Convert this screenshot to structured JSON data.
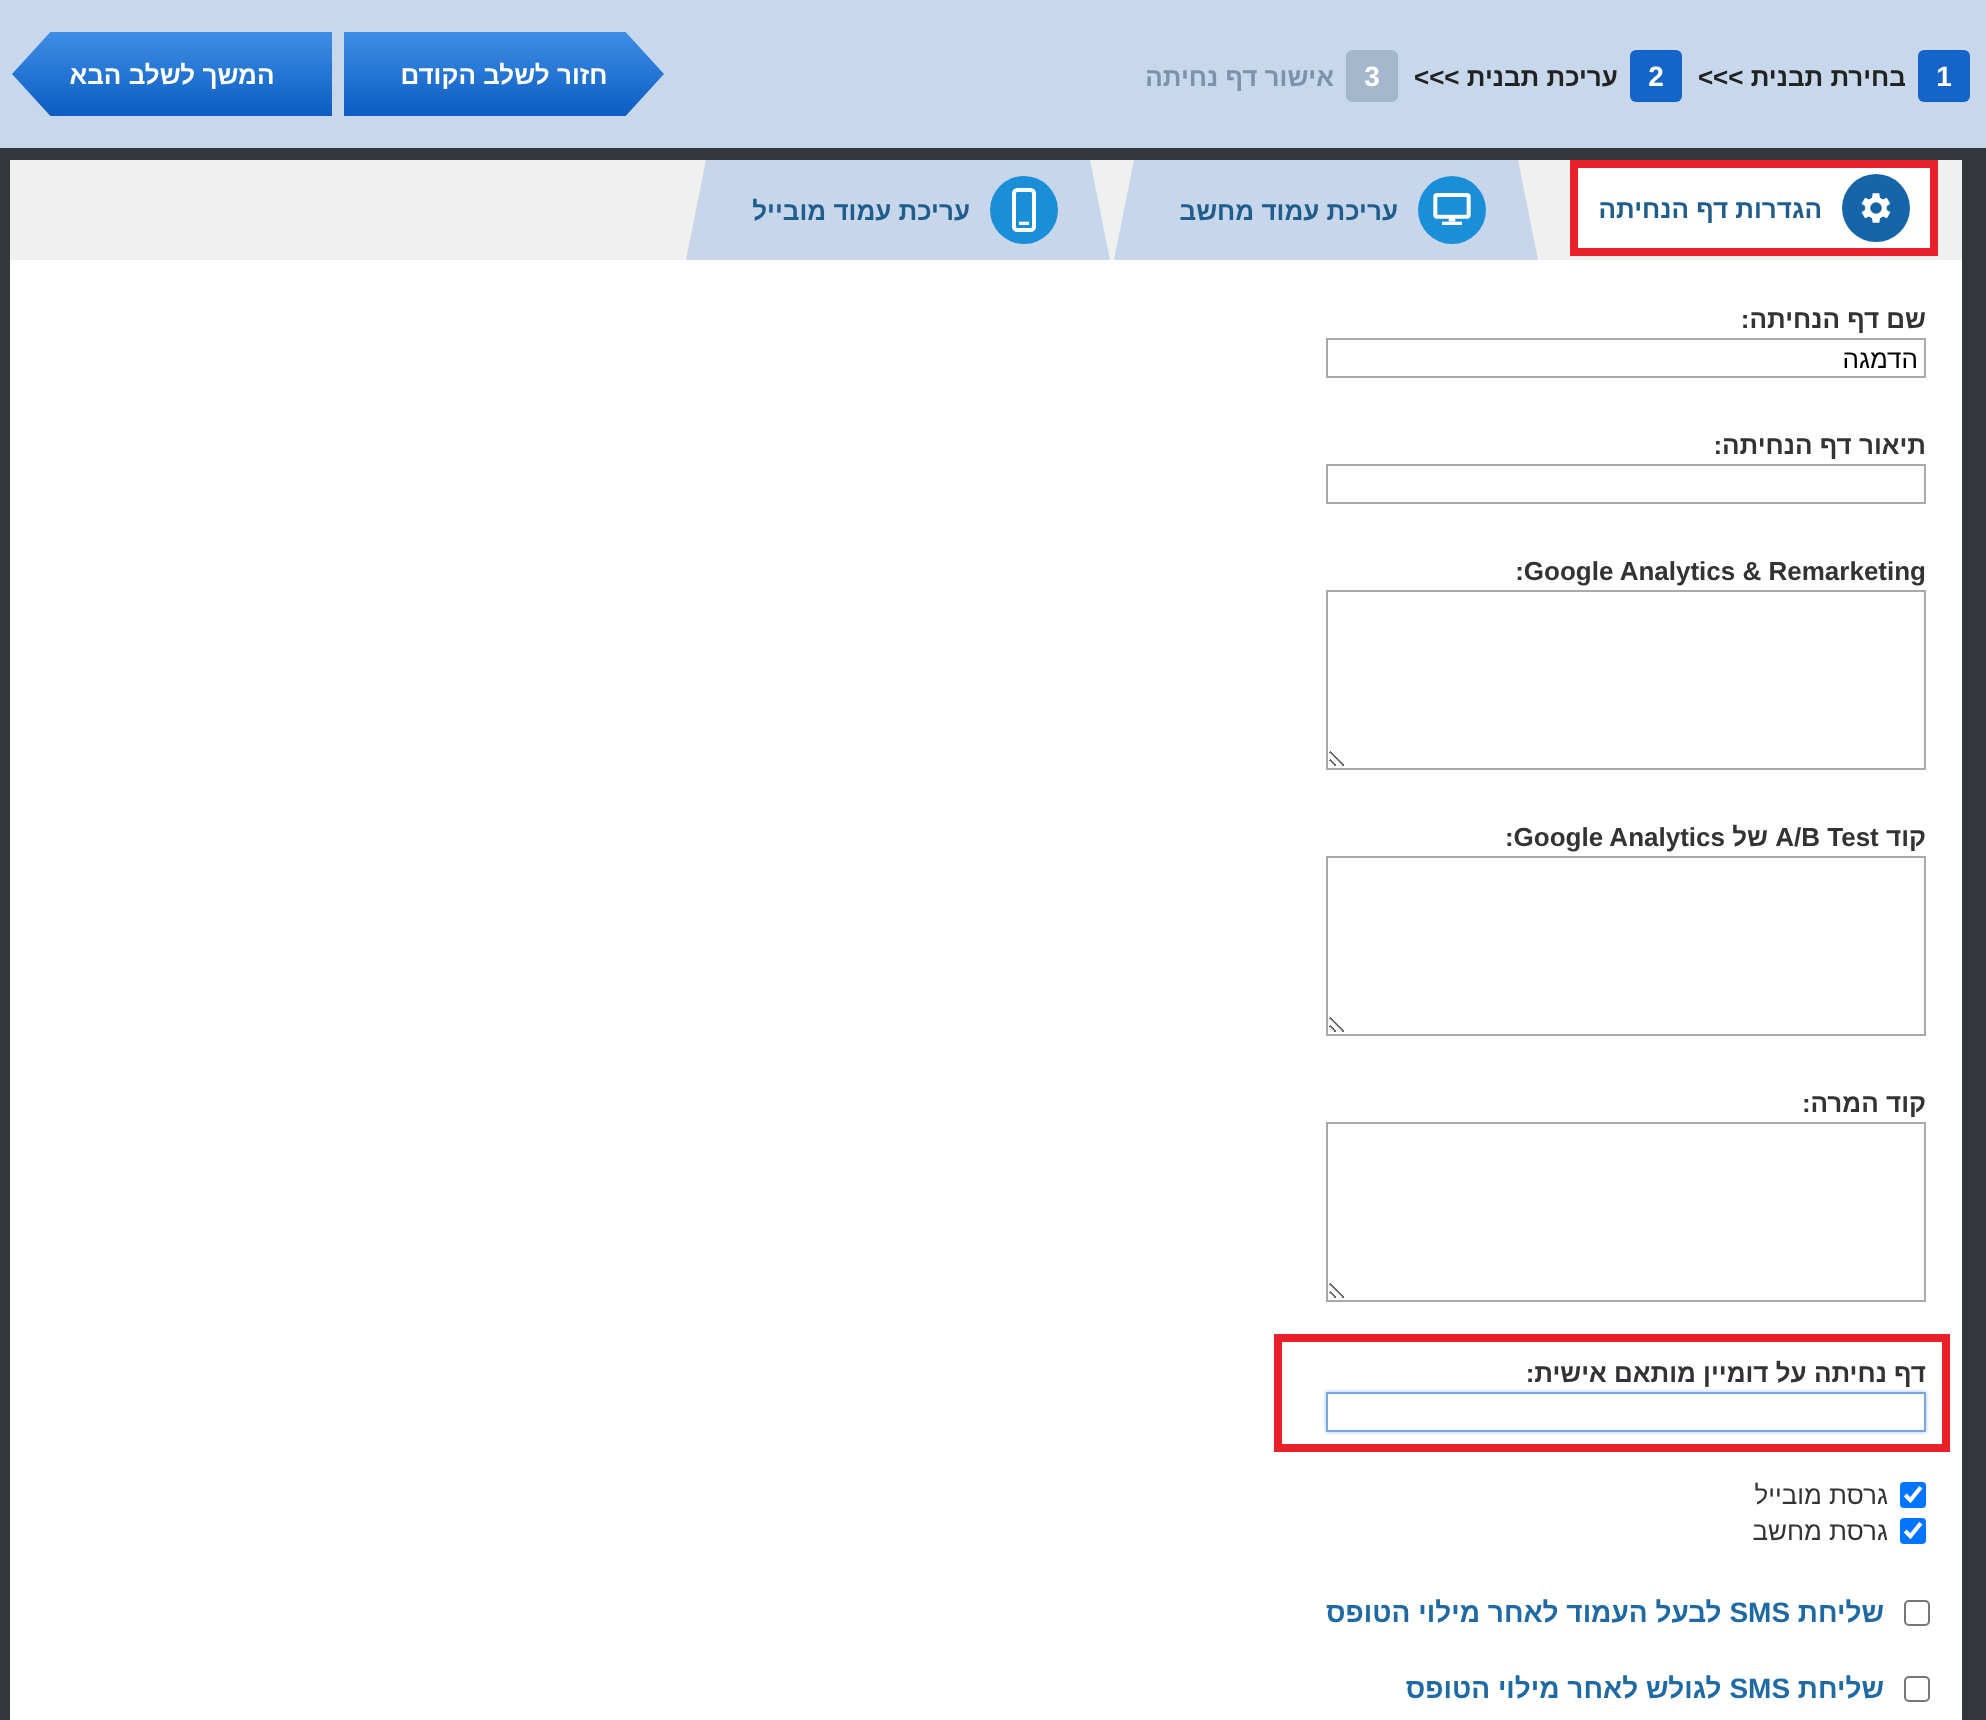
{
  "steps": [
    {
      "number": "1",
      "label": "בחירת תבנית >>>",
      "active": true
    },
    {
      "number": "2",
      "label": "עריכת תבנית >>>",
      "active": true
    },
    {
      "number": "3",
      "label": "אישור דף נחיתה",
      "active": false
    }
  ],
  "buttons": [
    {
      "label": "חזור לשלב הקודם",
      "kind": "back"
    },
    {
      "label": "המשך לשלב הבא",
      "kind": "next"
    }
  ],
  "tabs": [
    {
      "label": "הגדרות דף הנחיתה",
      "kind": "gear",
      "selected": true,
      "highlighted": true
    },
    {
      "label": "עריכת עמוד מחשב",
      "kind": "monitor",
      "selected": false,
      "highlighted": false
    },
    {
      "label": "עריכת עמוד מובייל",
      "kind": "phone",
      "selected": false,
      "highlighted": false
    }
  ],
  "fields": [
    {
      "label": "שם דף הנחיתה:",
      "kind": "input",
      "value": "הדמגה",
      "focused": false,
      "highlighted": false
    },
    {
      "label": "תיאור דף הנחיתה:",
      "kind": "input",
      "focused": false,
      "highlighted": false
    },
    {
      "label": "Google Analytics & Remarketing:",
      "kind": "textarea",
      "focused": false,
      "highlighted": false
    },
    {
      "label": "קוד A/B Test של Google Analytics:",
      "kind": "textarea",
      "focused": false,
      "highlighted": false
    },
    {
      "label": "קוד המרה:",
      "kind": "textarea",
      "focused": false,
      "highlighted": false
    },
    {
      "label": "דף נחיתה על דומיין מותאם אישית:",
      "kind": "input",
      "focused": true,
      "highlighted": true
    }
  ],
  "versions": [
    {
      "label": "גרסת מובייל",
      "checked": true
    },
    {
      "label": "גרסת מחשב",
      "checked": true
    }
  ],
  "sms_options": [
    {
      "label": "שליחת SMS לבעל העמוד לאחר מילוי הטופס",
      "checked": false
    },
    {
      "label": "שליחת SMS לגולש לאחר מילוי הטופס",
      "checked": false
    }
  ]
}
